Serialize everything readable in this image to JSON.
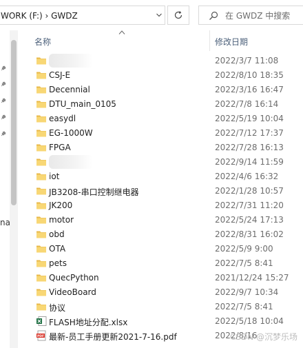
{
  "address": {
    "path": "WORK (F:)  ›  GWDZ"
  },
  "search": {
    "placeholder": "在 GWDZ 中搜索"
  },
  "left_pane": {
    "cut_label": "na"
  },
  "columns": {
    "name": "名称",
    "date": "修改日期"
  },
  "files": [
    {
      "name": "",
      "date": "2022/3/7 11:08",
      "type": "folder",
      "redacted": true
    },
    {
      "name": "CSJ-E",
      "date": "2022/8/10 18:35",
      "type": "folder"
    },
    {
      "name": "Decennial",
      "date": "2022/3/16 16:47",
      "type": "folder"
    },
    {
      "name": "DTU_main_0105",
      "date": "2022/7/8 16:14",
      "type": "folder"
    },
    {
      "name": "easydl",
      "date": "2022/5/19 10:04",
      "type": "folder"
    },
    {
      "name": "EG-1000W",
      "date": "2022/7/12 17:37",
      "type": "folder"
    },
    {
      "name": "FPGA",
      "date": "2022/7/28 16:13",
      "type": "folder"
    },
    {
      "name": "",
      "date": "2022/9/14 11:59",
      "type": "folder",
      "redacted": true
    },
    {
      "name": "iot",
      "date": "2022/4/6 16:32",
      "type": "folder"
    },
    {
      "name": "JB3208-串口控制继电器",
      "date": "2022/1/28 10:57",
      "type": "folder"
    },
    {
      "name": "JK200",
      "date": "2022/7/31 11:20",
      "type": "folder"
    },
    {
      "name": "motor",
      "date": "2022/5/24 17:13",
      "type": "folder"
    },
    {
      "name": "obd",
      "date": "2022/8/31 16:02",
      "type": "folder"
    },
    {
      "name": "OTA",
      "date": "2022/5/9 9:00",
      "type": "folder"
    },
    {
      "name": "pets",
      "date": "2022/7/5 8:41",
      "type": "folder"
    },
    {
      "name": "QuecPython",
      "date": "2021/12/24 15:27",
      "type": "folder"
    },
    {
      "name": "VideoBoard",
      "date": "2022/9/7 10:34",
      "type": "folder"
    },
    {
      "name": "协议",
      "date": "2022/7/5 8:41",
      "type": "folder"
    },
    {
      "name": "FLASH地址分配.xlsx",
      "date": "2022/5/18 10:04",
      "type": "excel"
    },
    {
      "name": "最新-员工手册更新2021-7-16.pdf",
      "date": "2022/8/16",
      "type": "pdf"
    }
  ],
  "watermark": "CSDN @沉梦乐场",
  "colors": {
    "folder": "#f8d775",
    "folder_dark": "#e8b84a",
    "excel": "#1d6f42",
    "pdf": "#d93025"
  }
}
